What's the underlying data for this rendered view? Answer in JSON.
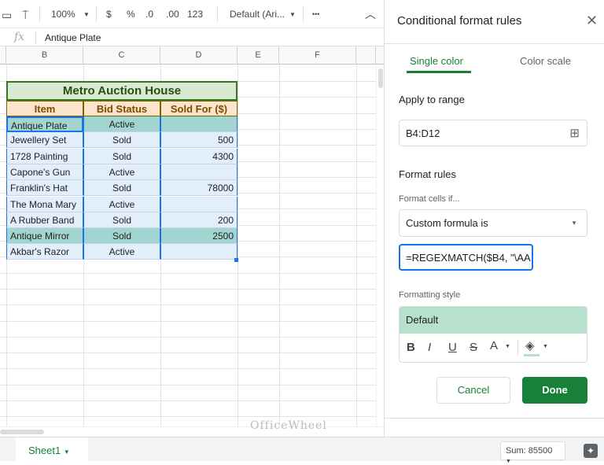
{
  "toolbar": {
    "zoom": "100%",
    "currency": "$",
    "percent": "%",
    "dec_less": ".0",
    "dec_more": ".00",
    "format_more": "123",
    "font": "Default (Ari...",
    "more": "•••"
  },
  "formula_bar": {
    "fx": "fx",
    "value": "Antique Plate"
  },
  "columns": [
    "B",
    "C",
    "D",
    "E",
    "F"
  ],
  "sheet": {
    "title": "Metro Auction House",
    "headers": [
      "Item",
      "Bid Status",
      "Sold For ($)"
    ],
    "rows": [
      [
        "Antique Plate",
        "Active",
        ""
      ],
      [
        "Jewellery Set",
        "Sold",
        "500"
      ],
      [
        "1728 Painting",
        "Sold",
        "4300"
      ],
      [
        "Capone's Gun",
        "Active",
        ""
      ],
      [
        "Franklin's Hat",
        "Sold",
        "78000"
      ],
      [
        "The Mona Mary",
        "Active",
        ""
      ],
      [
        "A Rubber Band",
        "Sold",
        "200"
      ],
      [
        "Antique Mirror",
        "Sold",
        "2500"
      ],
      [
        "Akbar's Razor",
        "Active",
        ""
      ]
    ],
    "highlighted_rows": [
      0,
      7
    ]
  },
  "panel": {
    "title": "Conditional format rules",
    "tabs": [
      "Single color",
      "Color scale"
    ],
    "apply_label": "Apply to range",
    "range": "B4:D12",
    "rules_label": "Format rules",
    "cells_if_label": "Format cells if...",
    "condition": "Custom formula is",
    "formula": "=REGEXMATCH($B4, \"\\AA",
    "style_label": "Formatting style",
    "style_preview": "Default",
    "bold": "B",
    "italic": "I",
    "underline": "U",
    "strike": "S",
    "text_color": "A",
    "cancel": "Cancel",
    "done": "Done"
  },
  "footer": {
    "sheet_tab": "Sheet1",
    "sum": "Sum: 85500",
    "watermark": "OfficeWheel"
  },
  "colors": {
    "accent": "#188038",
    "highlight": "#a2d5cf",
    "range_bg": "#e3eefb",
    "title_bg": "#d9ead3",
    "header_bg": "#fce5cd",
    "style_bg": "#b7e1cd"
  }
}
